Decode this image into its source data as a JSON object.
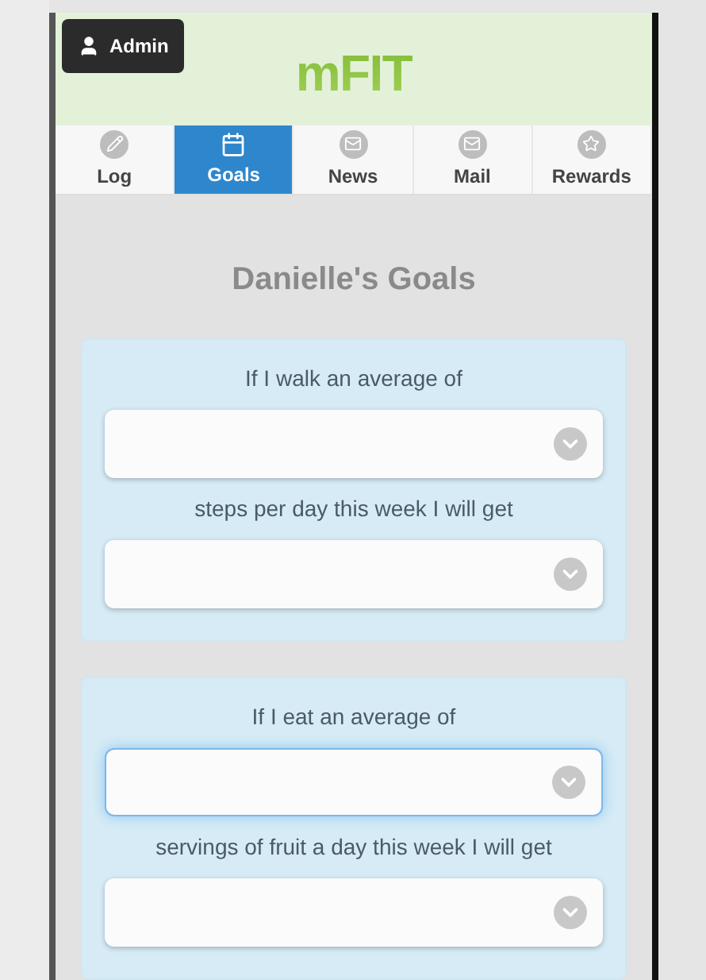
{
  "header": {
    "admin_button": "Admin",
    "logo": "mFIT"
  },
  "tabs": [
    {
      "label": "Log",
      "kind": "pencil",
      "selected": false
    },
    {
      "label": "Goals",
      "kind": "calendar",
      "selected": true
    },
    {
      "label": "News",
      "kind": "mail",
      "selected": false
    },
    {
      "label": "Mail",
      "kind": "mail",
      "selected": false
    },
    {
      "label": "Rewards",
      "kind": "star",
      "selected": false
    }
  ],
  "title": "Danielle's Goals",
  "goals": [
    {
      "prompt": "If I walk an average of",
      "amount_select": {
        "focused": false
      },
      "middle": "steps per day this week I will get",
      "reward_select": {
        "focused": false
      }
    },
    {
      "prompt": "If I eat an average of",
      "amount_select": {
        "focused": true
      },
      "middle": "servings of fruit a day this week I will get",
      "reward_select": {
        "focused": false
      }
    }
  ]
}
